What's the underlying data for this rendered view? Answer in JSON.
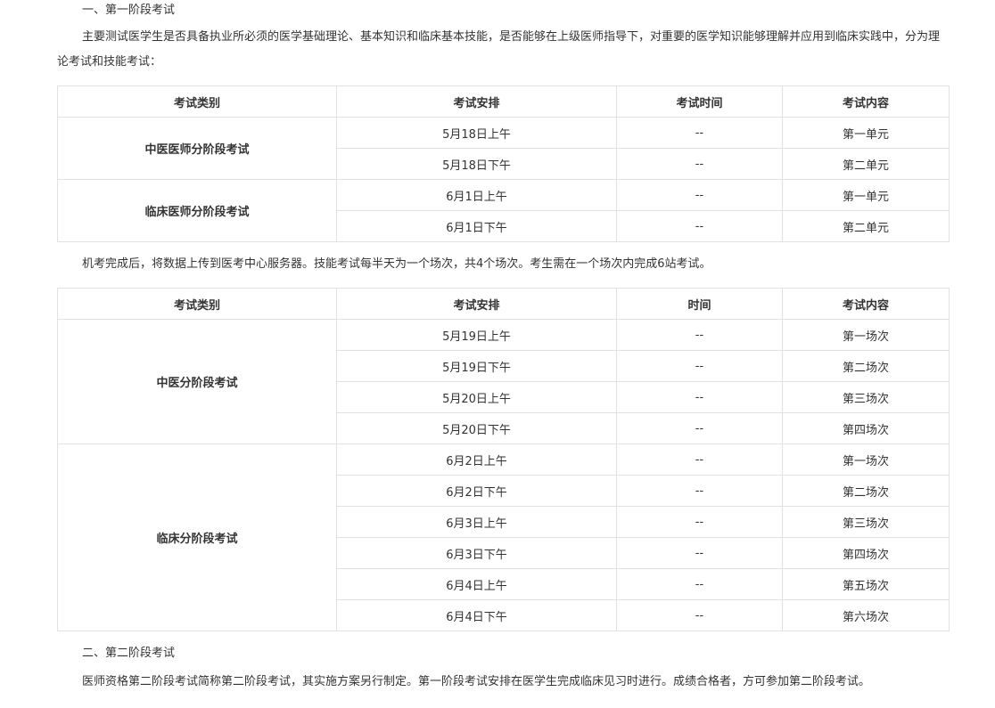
{
  "section1": {
    "heading": "一、第一阶段考试",
    "intro": "主要测试医学生是否具备执业所必须的医学基础理论、基本知识和临床基本技能，是否能够在上级医师指导下，对重要的医学知识能够理解并应用到临床实践中，分为理论考试和技能考试："
  },
  "table1": {
    "headers": [
      "考试类别",
      "考试安排",
      "考试时间",
      "考试内容"
    ],
    "groups": [
      {
        "category": "中医医师分阶段考试",
        "rows": [
          {
            "schedule": "5月18日上午",
            "time": "--",
            "content": "第一单元"
          },
          {
            "schedule": "5月18日下午",
            "time": "--",
            "content": "第二单元"
          }
        ]
      },
      {
        "category": "临床医师分阶段考试",
        "rows": [
          {
            "schedule": "6月1日上午",
            "time": "--",
            "content": "第一单元"
          },
          {
            "schedule": "6月1日下午",
            "time": "--",
            "content": "第二单元"
          }
        ]
      }
    ]
  },
  "middle_text": "机考完成后，将数据上传到医考中心服务器。技能考试每半天为一个场次，共4个场次。考生需在一个场次内完成6站考试。",
  "table2": {
    "headers": [
      "考试类别",
      "考试安排",
      "时间",
      "考试内容"
    ],
    "groups": [
      {
        "category": "中医分阶段考试",
        "rows": [
          {
            "schedule": "5月19日上午",
            "time": "--",
            "content": "第一场次"
          },
          {
            "schedule": "5月19日下午",
            "time": "--",
            "content": "第二场次"
          },
          {
            "schedule": "5月20日上午",
            "time": "--",
            "content": "第三场次"
          },
          {
            "schedule": "5月20日下午",
            "time": "--",
            "content": "第四场次"
          }
        ]
      },
      {
        "category": "临床分阶段考试",
        "rows": [
          {
            "schedule": "6月2日上午",
            "time": "--",
            "content": "第一场次"
          },
          {
            "schedule": "6月2日下午",
            "time": "--",
            "content": "第二场次"
          },
          {
            "schedule": "6月3日上午",
            "time": "--",
            "content": "第三场次"
          },
          {
            "schedule": "6月3日下午",
            "time": "--",
            "content": "第四场次"
          },
          {
            "schedule": "6月4日上午",
            "time": "--",
            "content": "第五场次"
          },
          {
            "schedule": "6月4日下午",
            "time": "--",
            "content": "第六场次"
          }
        ]
      }
    ]
  },
  "section2": {
    "heading": "二、第二阶段考试",
    "text": "医师资格第二阶段考试简称第二阶段考试，其实施方案另行制定。第一阶段考试安排在医学生完成临床见习时进行。成绩合格者，方可参加第二阶段考试。"
  }
}
